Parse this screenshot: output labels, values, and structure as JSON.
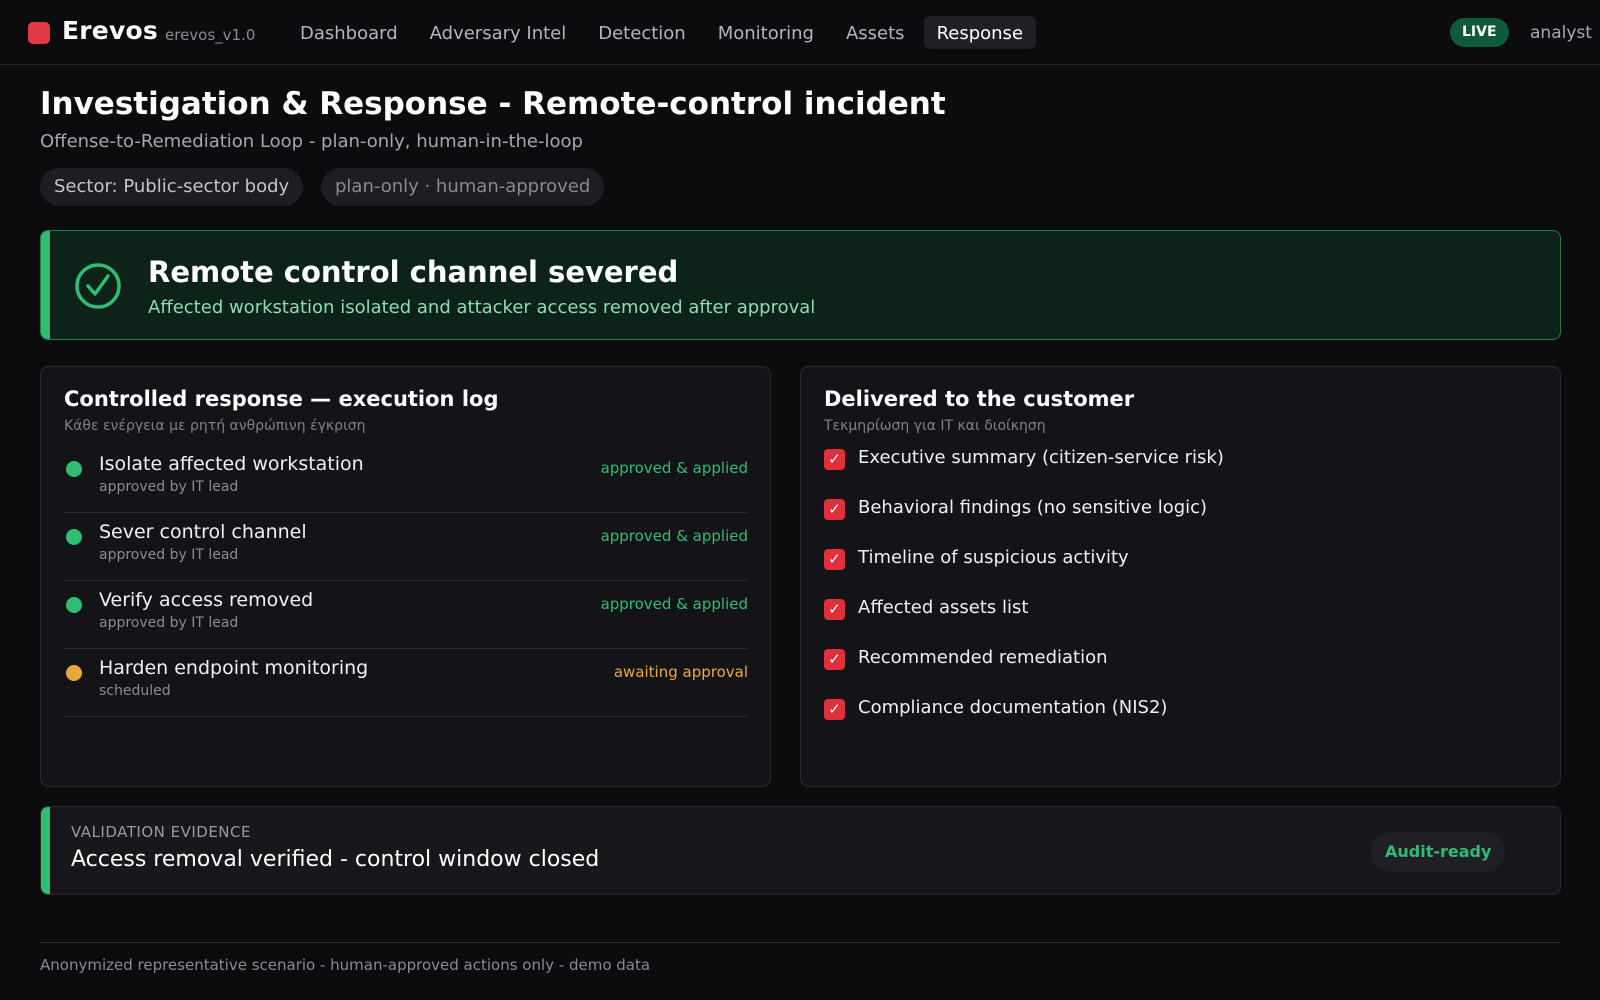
{
  "app": {
    "name": "Erevos",
    "version": "erevos_v1.0",
    "brand_color": "#e23a44"
  },
  "nav": {
    "items": [
      {
        "label": "Dashboard",
        "active": false
      },
      {
        "label": "Adversary Intel",
        "active": false
      },
      {
        "label": "Detection",
        "active": false
      },
      {
        "label": "Monitoring",
        "active": false
      },
      {
        "label": "Assets",
        "active": false
      },
      {
        "label": "Response",
        "active": true
      }
    ]
  },
  "header": {
    "live_label": "LIVE",
    "user": "analyst"
  },
  "page": {
    "title": "Investigation & Response - Remote-control incident",
    "subtitle": "Offense-to-Remediation Loop - plan-only, human-in-the-loop",
    "chips": {
      "sector": "Sector: Public-sector body",
      "mode": "plan-only · human-approved"
    }
  },
  "alert": {
    "icon": "check-circle-icon",
    "title": "Remote control channel severed",
    "description": "Affected workstation isolated and attacker access removed after approval",
    "color": "#2ebd72"
  },
  "execution_log": {
    "title": "Controlled response — execution log",
    "subtitle": "Κάθε ενέργεια με ρητή ανθρώπινη έγκριση",
    "items": [
      {
        "name": "Isolate affected workstation",
        "by": "approved by IT lead",
        "status": "approved & applied",
        "state": "done"
      },
      {
        "name": "Sever control channel",
        "by": "approved by IT lead",
        "status": "approved & applied",
        "state": "done"
      },
      {
        "name": "Verify access removed",
        "by": "approved by IT lead",
        "status": "approved & applied",
        "state": "done"
      },
      {
        "name": "Harden endpoint monitoring",
        "by": "scheduled",
        "status": "awaiting approval",
        "state": "pending"
      }
    ],
    "colors": {
      "done": "#2ebd72",
      "pending": "#e8a83a"
    }
  },
  "deliverables": {
    "title": "Delivered to the customer",
    "subtitle": "Τεκμηρίωση για IT και διοίκηση",
    "check_icon": "checkbox-checked-icon",
    "check_glyph": "✓",
    "items": [
      "Executive summary (citizen-service risk)",
      "Behavioral findings (no sensitive logic)",
      "Timeline of suspicious activity",
      "Affected assets list",
      "Recommended remediation",
      "Compliance documentation (NIS2)"
    ]
  },
  "evidence": {
    "kicker": "VALIDATION EVIDENCE",
    "text": "Access removal verified - control window closed",
    "badge": "Audit-ready"
  },
  "footer": {
    "note": "Anonymized representative scenario - human-approved actions only - demo data"
  }
}
